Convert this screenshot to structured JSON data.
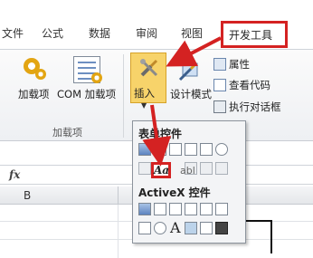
{
  "tabs": [
    {
      "id": "tab-left",
      "label": "文件"
    },
    {
      "id": "tab-formulas",
      "label": "公式"
    },
    {
      "id": "tab-data",
      "label": "数据"
    },
    {
      "id": "tab-review",
      "label": "审阅"
    },
    {
      "id": "tab-view",
      "label": "视图"
    },
    {
      "id": "tab-developer",
      "label": "开发工具"
    }
  ],
  "ribbon": {
    "addins_btn": "加载项",
    "com_btn": "COM 加载项",
    "addins_group": "加载项",
    "insert_btn": "插入",
    "design_mode_btn": "设计模式",
    "properties_btn": "属性",
    "view_code_btn": "查看代码",
    "run_dialog_btn": "执行对话框"
  },
  "formula_bar": {
    "fx": "fx"
  },
  "sheet": {
    "column": "B"
  },
  "insert_menu": {
    "form_controls_title": "表单控件",
    "label_control": "Aa",
    "text_ab": "abl",
    "activex_title": "ActiveX 控件",
    "activex_text": "A"
  },
  "colors": {
    "accent": "#d42222",
    "insert_highlight": "#f7d36a"
  }
}
